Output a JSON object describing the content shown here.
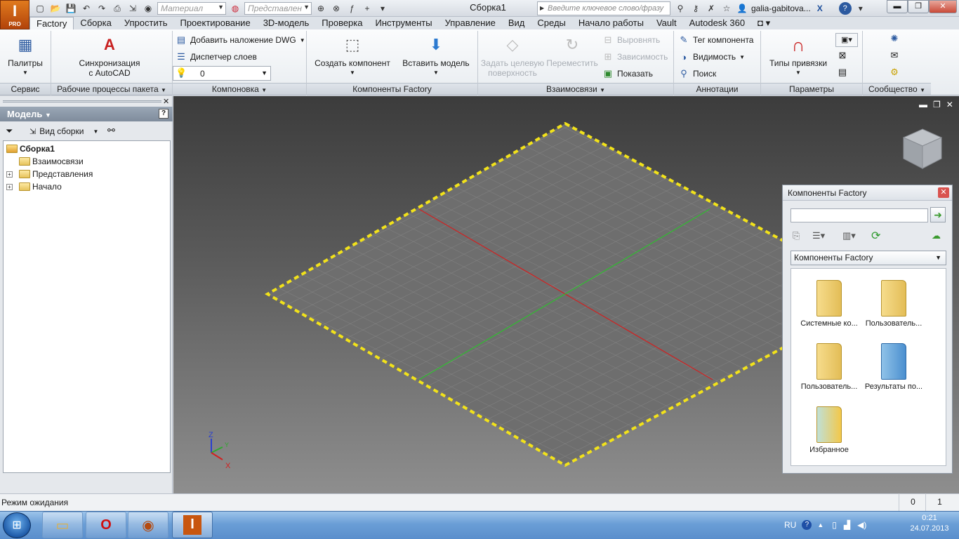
{
  "app": {
    "logo_letter": "I",
    "logo_sub": "PRO",
    "document_title": "Сборка1"
  },
  "qat": {
    "material_placeholder": "Материал",
    "view_rep_placeholder": "Представлен"
  },
  "search": {
    "placeholder": "Введите ключевое слово/фразу"
  },
  "user": {
    "name": "galia-gabitova..."
  },
  "menu_tabs": [
    "Factory",
    "Сборка",
    "Упростить",
    "Проектирование",
    "3D-модель",
    "Проверка",
    "Инструменты",
    "Управление",
    "Вид",
    "Среды",
    "Начало работы",
    "Vault",
    "Autodesk 360"
  ],
  "active_tab": "Factory",
  "ribbon": {
    "palettes": "Палитры",
    "sync_line1": "Синхронизация",
    "sync_line2": "с AutoCAD",
    "add_dwg": "Добавить наложение DWG",
    "layer_manager": "Диспетчер слоев",
    "layer_value": "0",
    "create_component": "Создать компонент",
    "insert_model": "Вставить модель",
    "set_target_line1": "Задать целевую",
    "set_target_line2": "поверхность",
    "move": "Переместить",
    "align": "Выровнять",
    "dependency": "Зависимость",
    "show": "Показать",
    "component_tag": "Тег компонента",
    "visibility": "Видимость",
    "search": "Поиск",
    "snap_types": "Типы привязки",
    "panels": [
      "Сервис",
      "Рабочие процессы пакета",
      "Компоновка",
      "Компоненты Factory",
      "Взаимосвязи",
      "Аннотации",
      "Параметры",
      "Сообщество"
    ]
  },
  "browser": {
    "title": "Модель",
    "view_label": "Вид сборки",
    "tree": [
      "Сборка1",
      "Взаимосвязи",
      "Представления",
      "Начало"
    ]
  },
  "viewport": {
    "axis_z": "Z",
    "axis_x": "X",
    "axis_y": "Y"
  },
  "factory_panel": {
    "title": "Компоненты Factory",
    "dropdown_value": "Компоненты Factory",
    "items": [
      "Системные ко...",
      "Пользователь...",
      "Пользователь...",
      "Результаты по...",
      "Избранное"
    ]
  },
  "status": {
    "text": "Режим ожидания",
    "num1": "0",
    "num2": "1"
  },
  "taskbar": {
    "lang": "RU",
    "time": "0:21",
    "date": "24.07.2013"
  },
  "colors": {
    "accent_orange": "#c8560f",
    "grid_red": "#d22020",
    "grid_green": "#2fbf2f",
    "boundary_yellow": "#f2e21a"
  }
}
